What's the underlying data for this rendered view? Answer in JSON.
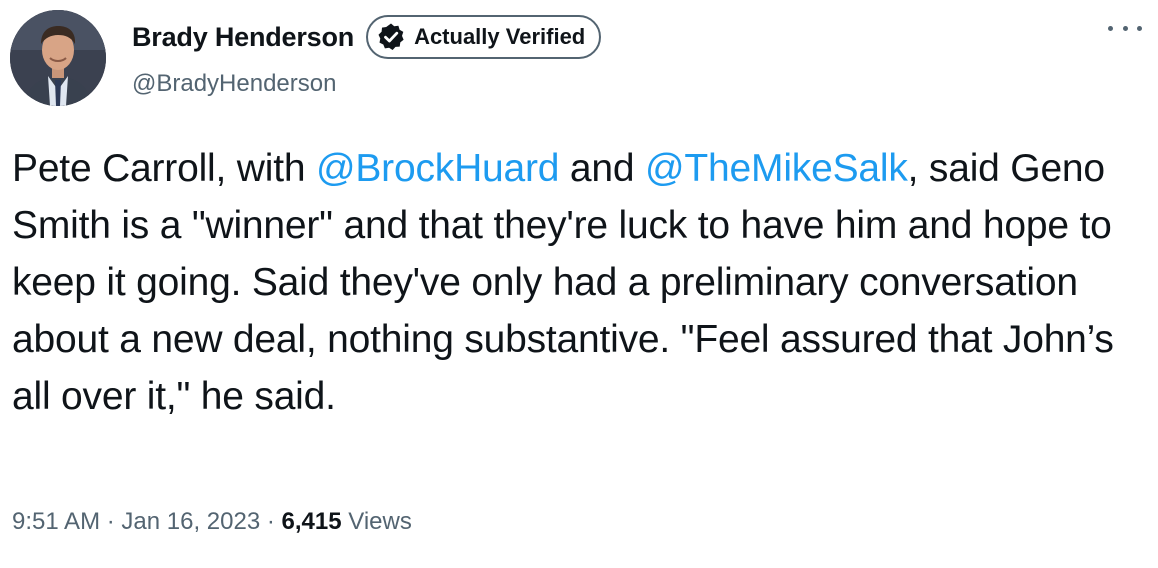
{
  "author": {
    "display_name": "Brady Henderson",
    "handle": "@BradyHenderson",
    "badge_label": "Actually Verified",
    "avatar_icon": "profile-photo"
  },
  "more_icon": "more-options-icon",
  "tweet": {
    "segments": [
      {
        "type": "text",
        "value": "Pete Carroll, with "
      },
      {
        "type": "mention",
        "value": "@BrockHuard"
      },
      {
        "type": "text",
        "value": " and "
      },
      {
        "type": "mention",
        "value": "@TheMikeSalk"
      },
      {
        "type": "text",
        "value": ", said Geno Smith is a \"winner\" and that they're luck to have him and hope to keep it going. Said they've only had a preliminary conversation about a new deal, nothing substantive. \"Feel assured that John’s all over it,\" he said."
      }
    ]
  },
  "meta": {
    "time": "9:51 AM",
    "separator": " · ",
    "date": "Jan 16, 2023",
    "views_count": "6,415",
    "views_label": " Views"
  },
  "colors": {
    "mention": "#1d9bf0",
    "secondary_text": "#536471",
    "primary_text": "#0f1419"
  }
}
